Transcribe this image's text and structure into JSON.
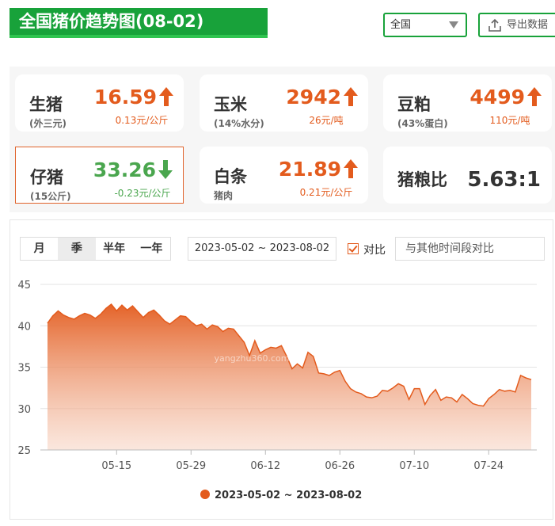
{
  "header": {
    "title": "全国猪价趋势图(08-02)",
    "region": "全国",
    "export_label": "导出数据"
  },
  "cards": [
    {
      "name": "生猪",
      "sub": "(外三元)",
      "price": "16.59",
      "change": "0.13元/公斤",
      "direction": "up"
    },
    {
      "name": "玉米",
      "sub": "(14%水分)",
      "price": "2942",
      "change": "26元/吨",
      "direction": "up"
    },
    {
      "name": "豆粕",
      "sub": "(43%蛋白)",
      "price": "4499",
      "change": "110元/吨",
      "direction": "up"
    },
    {
      "name": "仔猪",
      "sub": "(15公斤)",
      "price": "33.26",
      "change": "-0.23元/公斤",
      "direction": "down"
    },
    {
      "name": "白条",
      "sub": "猪肉",
      "price": "21.89",
      "change": "0.21元/公斤",
      "direction": "up"
    },
    {
      "name": "猪粮比",
      "ratio": "5.63:1"
    }
  ],
  "controls": {
    "periods": [
      "月",
      "季",
      "半年",
      "一年"
    ],
    "active_period": "季",
    "date_range": "2023-05-02 ~ 2023-08-02",
    "compare_label": "对比",
    "compare_checked": true,
    "compare_placeholder": "与其他时间段对比"
  },
  "colors": {
    "brand_green": "#18a23a",
    "up": "#e35b1d",
    "down": "#4aa64e",
    "series": "#e35b1d"
  },
  "chart_data": {
    "type": "area",
    "title": "",
    "xlabel": "",
    "ylabel": "",
    "ylim": [
      25,
      45
    ],
    "yticks": [
      25,
      30,
      35,
      40,
      45
    ],
    "x_tick_labels": [
      "05-15",
      "05-29",
      "06-12",
      "06-26",
      "07-10",
      "07-24"
    ],
    "x_tick_days": [
      13,
      27,
      41,
      55,
      69,
      83
    ],
    "x_start": "2023-05-02",
    "x_end": "2023-08-02",
    "grid": true,
    "legend_position": "bottom",
    "series": [
      {
        "name": "2023-05-02 ~ 2023-08-02",
        "values": [
          40.3,
          41.2,
          41.8,
          41.3,
          41.0,
          40.8,
          41.2,
          41.5,
          41.3,
          40.9,
          41.4,
          42.1,
          42.6,
          41.8,
          42.5,
          41.9,
          42.4,
          41.7,
          41.0,
          41.6,
          41.9,
          41.3,
          40.6,
          40.2,
          40.7,
          41.2,
          41.1,
          40.5,
          40.0,
          40.2,
          39.6,
          40.1,
          39.9,
          39.3,
          39.7,
          39.6,
          38.8,
          38.0,
          36.4,
          38.2,
          36.7,
          37.1,
          37.4,
          37.3,
          37.6,
          36.3,
          34.8,
          35.4,
          34.9,
          36.8,
          36.3,
          34.3,
          34.2,
          34.0,
          34.4,
          34.6,
          33.3,
          32.4,
          32.0,
          31.8,
          31.4,
          31.3,
          31.5,
          32.2,
          32.1,
          32.5,
          33.0,
          32.7,
          31.1,
          32.4,
          32.4,
          30.5,
          31.6,
          32.3,
          31.0,
          31.4,
          31.3,
          30.8,
          31.7,
          31.2,
          30.6,
          30.4,
          30.3,
          31.2,
          31.7,
          32.3,
          32.1,
          32.2,
          32.0,
          34.0,
          33.7,
          33.5
        ]
      }
    ],
    "watermark": "yangzhu360.com"
  }
}
